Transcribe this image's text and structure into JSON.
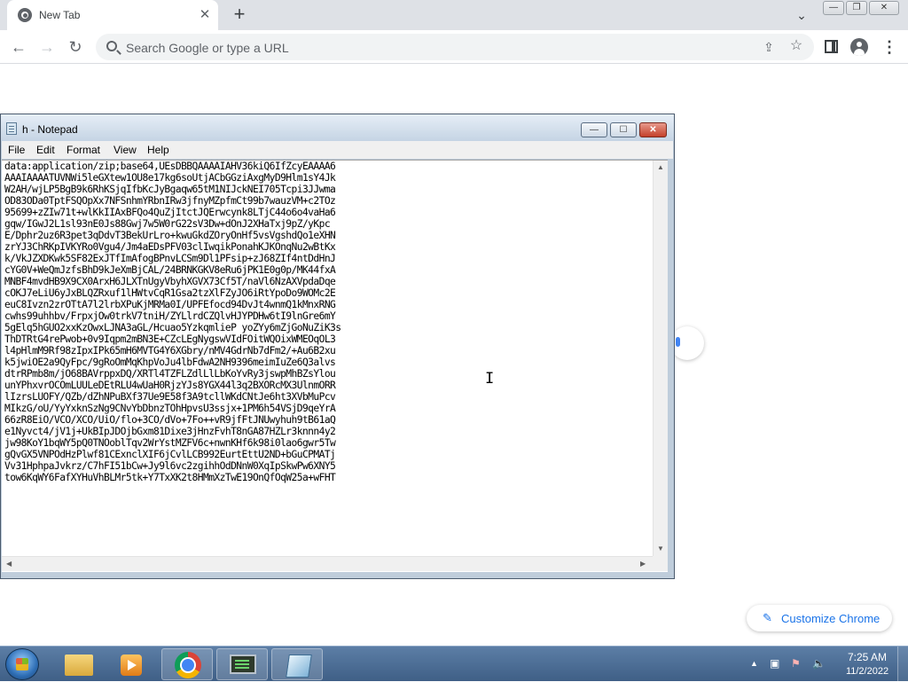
{
  "browser": {
    "tab": {
      "title": "New Tab",
      "close_glyph": "✕",
      "icon": "chrome-newtab-icon"
    },
    "new_tab_glyph": "+",
    "tab_search_glyph": "⌄",
    "window_buttons": {
      "minimize": "—",
      "restore": "❐",
      "close": "✕"
    },
    "toolbar": {
      "back_glyph": "←",
      "forward_glyph": "→",
      "reload_glyph": "↻",
      "omnibox_placeholder": "Search Google or type a URL",
      "share_glyph": "⇪",
      "bookmark_glyph": "☆",
      "menu_glyph": "⋮"
    },
    "customize": {
      "label": "Customize Chrome",
      "icon_glyph": "✎"
    },
    "accent_color": "#1a73e8"
  },
  "notepad": {
    "title": "h - Notepad",
    "buttons": {
      "minimize": "—",
      "maximize": "☐",
      "close": "✕"
    },
    "menu": [
      "File",
      "Edit",
      "Format",
      "View",
      "Help"
    ],
    "lines": [
      "data:application/zip;base64,UEsDBBQAAAAIAHV36kiQ6IfZcyEAAAA6",
      "AAAIAAAATUVNWi5leGXtew1OU8e17kg6soUtjACbGGziAxgMyD9Hlm1sY4Jk",
      "W2AH/wjLP5BgB9k6RhKSjqIfbKcJyBgaqw65tM1NIJckNEI705Tcpi3JJwma",
      "OD83ODa0TptFSQOpXx7NFSnhmYRbnIRw3jfnyMZpfmCt99b7wauzVM+c2TOz",
      "95699+zZIw71t+wlKkIIAxBFQo4QuZjItctJQErwcynk8LTjC44o6o4vaHa6",
      "gqw/IGwJ2L1sl93nE0Js88Gwj7w5W0rG22sV3Dw+dOnJ2XHaTxj9pZ/yKpc",
      "E/Dphr2uz6R3pet3qDdvT3BekUrLro+kwuGkdZOryOnHf5vsVgshdQo1eXHN",
      "zrYJ3ChRKpIVKYRo0Vgu4/Jm4aEDsPFV03clIwqikPonahKJKOnqNu2wBtKx",
      "k/VkJZXDKwk5SF82ExJTfImAfogBPnvLCSm9Dl1PFsip+zJ68ZIf4ntDdHnJ",
      "cYG0V+WeQmJzfsBhD9kJeXmBjCAL/24BRNKGKV8eRu6jPK1E0g0p/MK44fxA",
      "MNBF4mvdHB9X9CX0ArxH6JLXTnUgyVbyhXGVX73Cf5T/naVl6NzAXVpdaDqe",
      "cOKJ7eLiU6yJxBLQZRxuf1lHWtvCqR1Gsa2tzXlFZyJO6iRtYpoDo9WOMc2E",
      "euC8Ivzn2zrOTtA7l2lrbXPuKjMRMa0I/UPFEfocd94DvJt4wnmQ1kMnxRNG",
      "cwhs99uhhbv/FrpxjOw0trkV7tniH/ZYLlrdCZQlvHJYPDHw6tI9lnGre6mY",
      "5gElq5hGUO2xxKzOwxLJNA3aGL/Hcuao5YzkqmlieP yoZYy6mZjGoNuZiK3s",
      "ThDTRtG4rePwob+0v9Iqpm2mBN3E+CZcLEgNygswVIdFOitWQOixWMEOqOL3",
      "l4pHlmM9Rf98zIpxIPk65mH6MVTG4Y6XGbry/nMV4GdrNb7dFm2/+Au6B2xu",
      "k5jwiOE2a9QyFpc/9gRoOmMqKhpVoJu4lbFdwA2NH9396meimIuZe6Q3alvs",
      "dtrRPmb8m/jO68BAVrppxDQ/XRTl4TZFLZdlLlLbKoYvRy3jswpMhBZsYlou",
      "unYPhxvrOCOmLUULeDEtRLU4wUaH0RjzYJs8YGX44l3q2BXORcMX3UlnmORR",
      "lIzrsLUOFY/QZb/dZhNPuBXf37Ue9E58f3A9tcllWKdCNtJe6ht3XVbMuPcv",
      "MIkzG/oU/YyYxknSzNg9CNvYbDbnzTOhHpvsU3ssjx+1PM6h54VSjD9qeYrA",
      "66zR8EiO/VCO/XCO/UiO/flo+3CO/dVo+7Fo++vR9jfFtJNUwyhuh9tB61aQ",
      "e1Nyvct4/jV1j+UkBIpJDOjbGxm81Dixe3jHnzFvhT8nGA87HZLr3knnn4y2",
      "jw98KoY1bqWY5pQ0TNOoblTqv2WrYstMZFV6c+nwnKHf6k98i0lao6gwr5Tw",
      "gQvGX5VNPOdHzPlwf81CExnclXIF6jCvlLCB992EurtEttU2ND+bGuCPMATj",
      "Vv31HphpaJvkrz/C7hFI51bCw+Jy9l6vc2zgihhOdDNnW0XqIpSkwPw6XNY5",
      "tow6KqWY6FafXYHuVhBLMr5tk+Y7TxXK2t8HMmXzTwE19OnQfOqW25a+wFHT"
    ]
  },
  "taskbar": {
    "clock_time": "7:25 AM",
    "clock_date": "11/2/2022",
    "tray_glyphs": {
      "chevron": "▲",
      "network": "▣",
      "flag": "⚑",
      "volume": "🔈"
    }
  }
}
